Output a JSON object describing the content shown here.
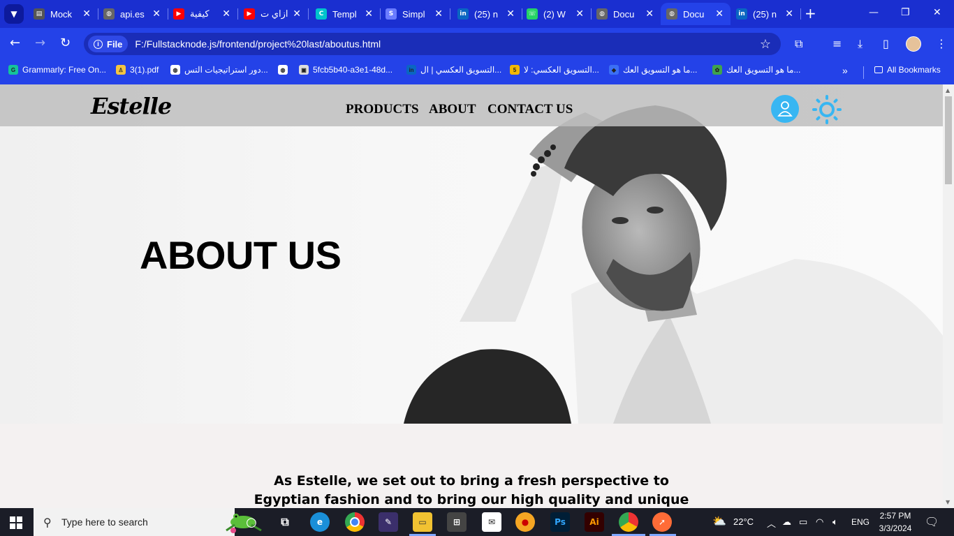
{
  "browser": {
    "tabs": [
      {
        "label": "Mock",
        "icon": "page-icon",
        "color": "#555"
      },
      {
        "label": "api.es",
        "icon": "globe-icon",
        "color": "#666"
      },
      {
        "label": "كيفية",
        "icon": "youtube-icon",
        "color": "#ff0000"
      },
      {
        "label": "ازاي ت",
        "icon": "youtube-icon",
        "color": "#ff0000"
      },
      {
        "label": "Templ",
        "icon": "canva-icon",
        "color": "#00c4cc"
      },
      {
        "label": "Simpl",
        "icon": "simplilearn-icon",
        "color": "#6b7cff"
      },
      {
        "label": "(25) n",
        "icon": "linkedin-icon",
        "color": "#0a66c2"
      },
      {
        "label": "(2) W",
        "icon": "whatsapp-icon",
        "color": "#25d366"
      },
      {
        "label": "Docu",
        "icon": "globe-icon",
        "color": "#666"
      },
      {
        "label": "Docu",
        "icon": "globe-icon",
        "color": "#666"
      },
      {
        "label": "(25) n",
        "icon": "linkedin-icon",
        "color": "#0a66c2"
      }
    ],
    "active_tab_index": 9,
    "address": {
      "chip_label": "File",
      "url": "F:/Fullstacknode.js/frontend/project%20last/aboutus.html"
    },
    "bookmarks": [
      {
        "label": "Grammarly: Free On...",
        "icon": "grammarly-icon",
        "color": "#15c39a"
      },
      {
        "label": "3(1).pdf",
        "icon": "pdf-icon",
        "color": "#f4c542"
      },
      {
        "label": "دور استراتيجيات التس...",
        "icon": "globe-icon",
        "color": "#fff"
      },
      {
        "label": "",
        "icon": "globe-icon",
        "color": "#fff"
      },
      {
        "label": "5fcb5b40-a3e1-48d...",
        "icon": "image-icon",
        "color": "#ddd"
      },
      {
        "label": "التسويق العكسي | ال...",
        "icon": "linkedin-icon",
        "color": "#0a66c2"
      },
      {
        "label": "التسويق العكسي: لا...",
        "icon": "number-five-icon",
        "color": "#f2b705"
      },
      {
        "label": "ما هو التسويق العك...",
        "icon": "bird-icon",
        "color": "#3b6ff5"
      },
      {
        "label": "ما هو التسويق العك...",
        "icon": "leaf-icon",
        "color": "#3fa34d"
      }
    ],
    "all_bookmarks_label": "All Bookmarks"
  },
  "site": {
    "logo": "Estelle",
    "nav": [
      "PRODUCTS",
      "ABOUT",
      "CONTACT US"
    ],
    "hero_title": "ABOUT US",
    "intro_lines": [
      "As Estelle, we set out to bring a fresh perspective to",
      "Egyptian fashion and to bring our high quality and unique"
    ],
    "accent_color": "#38b6f2"
  },
  "taskbar": {
    "search_placeholder": "Type here to search",
    "weather": "22°C",
    "language": "ENG",
    "time": "2:57 PM",
    "date": "3/3/2024"
  }
}
